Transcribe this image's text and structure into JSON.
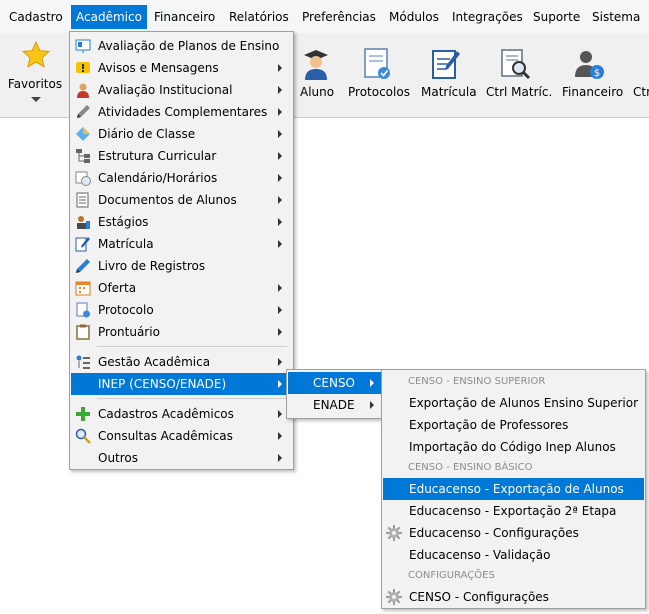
{
  "menubar": {
    "items": [
      "Cadastro",
      "Acadêmico",
      "Financeiro",
      "Relatórios",
      "Preferências",
      "Módulos",
      "Integrações",
      "Suporte",
      "Sistema"
    ]
  },
  "toolbar": {
    "favorites_label": "Favoritos",
    "items": [
      {
        "label": "Aluno",
        "icon": "student-icon"
      },
      {
        "label": "Protocolos",
        "icon": "document-check-icon"
      },
      {
        "label": "Matrícula",
        "icon": "edit-document-icon"
      },
      {
        "label": "Ctrl Matríc.",
        "icon": "document-search-icon"
      },
      {
        "label": "Financeiro",
        "icon": "user-money-icon"
      },
      {
        "label": "Ctr",
        "icon": "partial-icon"
      }
    ]
  },
  "academico_menu": {
    "items": [
      "Avaliação de Planos de Ensino",
      "Avisos e Mensagens",
      "Avaliação Institucional",
      "Atividades Complementares",
      "Diário de Classe",
      "Estrutura Curricular",
      "Calendário/Horários",
      "Documentos de Alunos",
      "Estágios",
      "Matrícula",
      "Livro de Registros",
      "Oferta",
      "Protocolo",
      "Prontuário",
      "Gestão Acadêmica",
      "INEP (CENSO/ENADE)",
      "Cadastros Acadêmicos",
      "Consultas Acadêmicas",
      "Outros"
    ]
  },
  "inep_menu": {
    "items": [
      "CENSO",
      "ENADE"
    ]
  },
  "censo_menu": {
    "header_superior": "CENSO - ENSINO SUPERIOR",
    "header_basico": "CENSO - ENSINO BÁSICO",
    "header_config": "CONFIGURAÇÕES",
    "items": [
      "Exportação de Alunos Ensino Superior",
      "Exportação de Professores",
      "Importação do Código Inep Alunos",
      "Educacenso - Exportação de Alunos",
      "Educacenso - Exportação 2ª Etapa",
      "Educacenso - Configurações",
      "Educacenso - Validação",
      "CENSO - Configurações"
    ]
  },
  "colors": {
    "highlight": "#0078d7",
    "menu_bg": "#f2f2f2",
    "toolbar_bg": "#f0f0f0"
  }
}
